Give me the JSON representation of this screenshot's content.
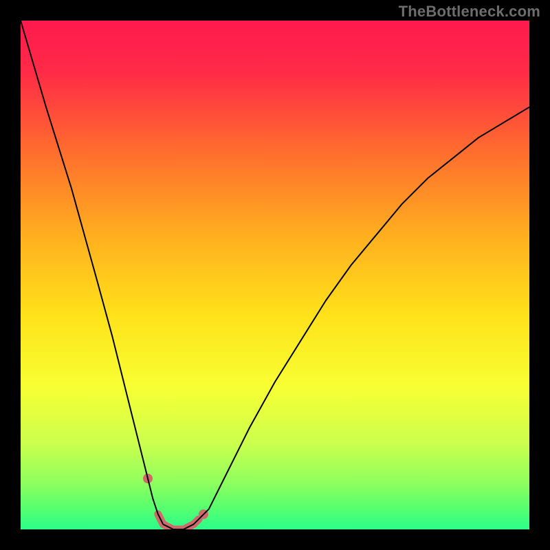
{
  "watermark": "TheBottleneck.com",
  "chart_data": {
    "type": "line",
    "title": "",
    "xlabel": "",
    "ylabel": "",
    "xlim": [
      0,
      100
    ],
    "ylim": [
      0,
      100
    ],
    "grid": false,
    "legend": false,
    "series": [
      {
        "name": "bottleneck-curve",
        "x": [
          0,
          5,
          10,
          15,
          18,
          20,
          22,
          24,
          26,
          27,
          28,
          30,
          32,
          34,
          35,
          37,
          40,
          45,
          50,
          55,
          60,
          65,
          70,
          75,
          80,
          85,
          90,
          95,
          100
        ],
        "values": [
          100,
          83,
          67,
          49,
          38,
          30,
          22,
          14,
          6,
          3,
          1,
          0,
          0,
          1,
          2,
          4,
          10,
          20,
          29,
          37,
          45,
          52,
          58,
          64,
          69,
          73,
          77,
          80,
          83
        ]
      },
      {
        "name": "optimal-range",
        "x": [
          27,
          28,
          30,
          32,
          34,
          35
        ],
        "values": [
          3,
          1,
          0,
          0,
          1,
          2
        ]
      }
    ],
    "annotations": [
      {
        "name": "left-dot",
        "x": 25,
        "y": 10
      },
      {
        "name": "right-dot",
        "x": 36,
        "y": 3
      }
    ],
    "background_gradient": {
      "top": "#ff1a4d",
      "mid": "#ffd400",
      "bottom": "#3dff7a"
    }
  }
}
